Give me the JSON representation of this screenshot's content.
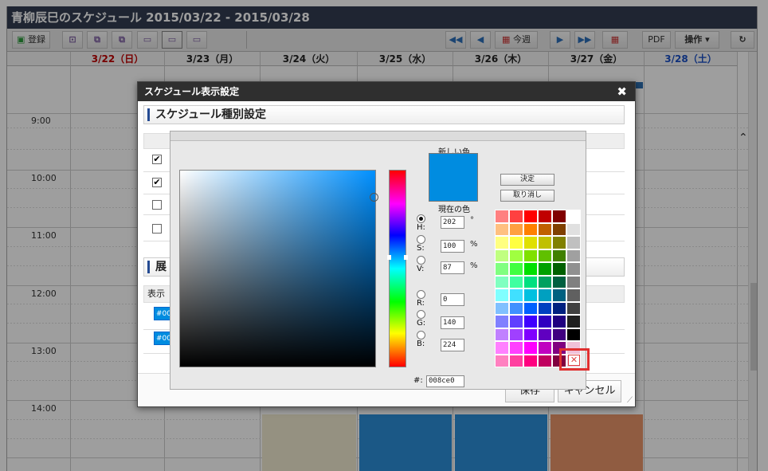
{
  "title": "青柳辰巳のスケジュール 2015/03/22 - 2015/03/28",
  "toolbar": {
    "register_label": "登録",
    "pdf_label": "PDF",
    "operation_label": "操作 ▾",
    "this_week_label": "今週"
  },
  "calendar": {
    "days": [
      {
        "label": "3/22（日）",
        "color": "#c00000"
      },
      {
        "label": "3/23（月）",
        "color": "#222222"
      },
      {
        "label": "3/24（火）",
        "color": "#222222"
      },
      {
        "label": "3/25（水）",
        "color": "#222222"
      },
      {
        "label": "3/26（木）",
        "color": "#222222"
      },
      {
        "label": "3/27（金）",
        "color": "#222222"
      },
      {
        "label": "3/28（土）",
        "color": "#1a4fc6"
      }
    ],
    "times": [
      "9:00",
      "10:00",
      "11:00",
      "12:00",
      "13:00",
      "14:00"
    ]
  },
  "dialog": {
    "title": "スケジュール表示設定",
    "section1": "スケジュール種別設定",
    "section2": "展",
    "display_header": "表示",
    "color_swatch_1": "#00",
    "color_swatch_2": "#00",
    "save_label": "保存",
    "cancel_label": "キャンセル",
    "checkbox_states": [
      true,
      true,
      false,
      false
    ]
  },
  "picker": {
    "new_color_label": "新しい色",
    "current_color_label": "現在の色",
    "ok_label": "決定",
    "cancel_label": "取り消し",
    "h_label": "H:",
    "s_label": "S:",
    "v_label": "V:",
    "r_label": "R:",
    "g_label": "G:",
    "b_label": "B:",
    "h_value": "202",
    "s_value": "100",
    "v_value": "87",
    "r_value": "0",
    "g_value": "140",
    "b_value": "224",
    "hex_label": "#:",
    "hex_value": "008ce0",
    "deg_unit": "°",
    "pct_unit": "%",
    "new_color": "#008ce0",
    "palette": [
      [
        "#ff8080",
        "#ff4040",
        "#ff0000",
        "#c00000",
        "#800000",
        "#ffffff"
      ],
      [
        "#ffc080",
        "#ffa040",
        "#ff8000",
        "#c06000",
        "#804000",
        "#e0e0e0"
      ],
      [
        "#ffff80",
        "#ffff40",
        "#e0e000",
        "#c0c000",
        "#808000",
        "#c0c0c0"
      ],
      [
        "#c0ff80",
        "#a0ff40",
        "#80e000",
        "#60c000",
        "#408000",
        "#a0a0a0"
      ],
      [
        "#80ff80",
        "#40ff40",
        "#00e000",
        "#00a000",
        "#006000",
        "#909090"
      ],
      [
        "#80ffc0",
        "#40ffa0",
        "#00e080",
        "#00a060",
        "#006040",
        "#808080"
      ],
      [
        "#80ffff",
        "#40e0ff",
        "#00c0e0",
        "#00a0c0",
        "#006080",
        "#606060"
      ],
      [
        "#80c0ff",
        "#4090ff",
        "#0060ff",
        "#0040c0",
        "#002080",
        "#404040"
      ],
      [
        "#8080ff",
        "#6040ff",
        "#4000ff",
        "#3000c0",
        "#200080",
        "#202020"
      ],
      [
        "#c080ff",
        "#a040ff",
        "#8000ff",
        "#6000c0",
        "#400080",
        "#000000"
      ],
      [
        "#ff80ff",
        "#ff40ff",
        "#ff00ff",
        "#c000c0",
        "#800080",
        "none"
      ],
      [
        "#ff80c0",
        "#ff40a0",
        "#ff0080",
        "#c00060",
        "#800040",
        "none"
      ]
    ]
  }
}
